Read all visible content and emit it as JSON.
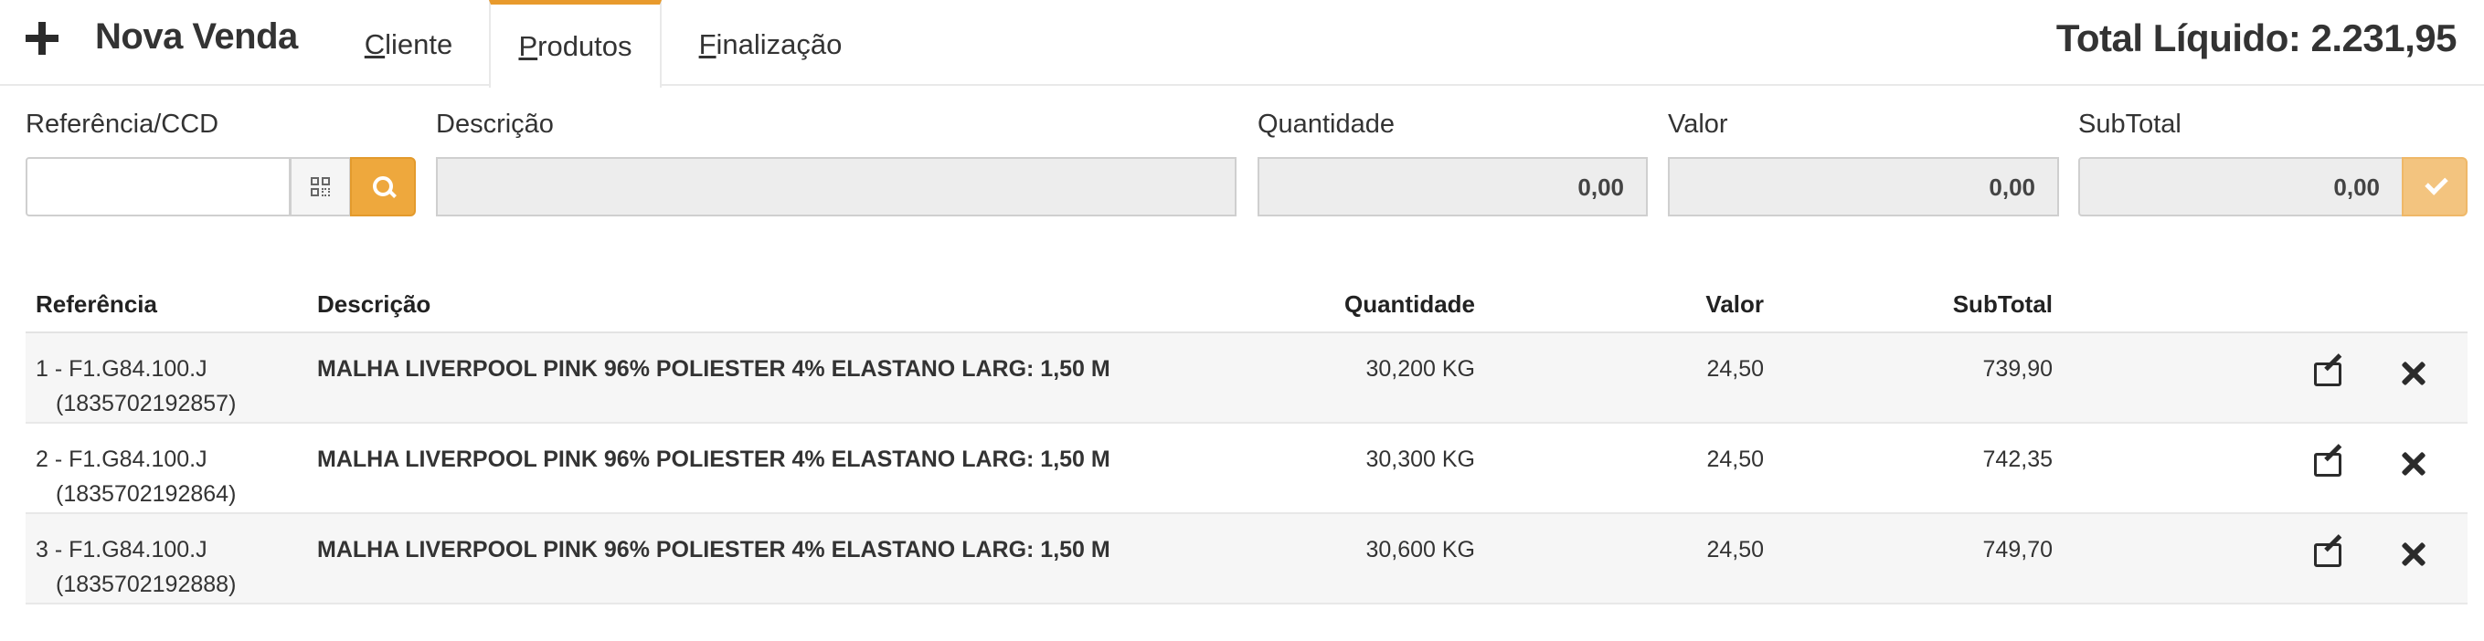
{
  "header": {
    "title": "Nova Venda",
    "tabs": [
      {
        "key": "C",
        "rest": "liente"
      },
      {
        "key": "P",
        "rest": "rodutos"
      },
      {
        "key": "F",
        "rest": "inalização"
      }
    ],
    "total_liquido": "Total Líquido: 2.231,95",
    "active_tab": "Produtos"
  },
  "form": {
    "ref_label": "Referência/CCD",
    "ref_value": "",
    "desc_label": "Descrição",
    "desc_value": "",
    "qtd_label": "Quantidade",
    "qtd_value": "0,00",
    "valor_label": "Valor",
    "valor_value": "0,00",
    "subtotal_label": "SubTotal",
    "subtotal_value": "0,00"
  },
  "table": {
    "headers": {
      "ref": "Referência",
      "desc": "Descrição",
      "qtd": "Quantidade",
      "valor": "Valor",
      "subtotal": "SubTotal"
    },
    "rows": [
      {
        "ref": "1 - F1.G84.100.J",
        "code": "(1835702192857)",
        "desc": "MALHA LIVERPOOL PINK 96% POLIESTER 4% ELASTANO LARG: 1,50 M",
        "qtd": "30,200 KG",
        "valor": "24,50",
        "subtotal": "739,90"
      },
      {
        "ref": "2 - F1.G84.100.J",
        "code": "(1835702192864)",
        "desc": "MALHA LIVERPOOL PINK 96% POLIESTER 4% ELASTANO LARG: 1,50 M",
        "qtd": "30,300 KG",
        "valor": "24,50",
        "subtotal": "742,35"
      },
      {
        "ref": "3 - F1.G84.100.J",
        "code": "(1835702192888)",
        "desc": "MALHA LIVERPOOL PINK 96% POLIESTER 4% ELASTANO LARG: 1,50 M",
        "qtd": "30,600 KG",
        "valor": "24,50",
        "subtotal": "749,70"
      }
    ]
  },
  "icons": {
    "add": "plus-icon",
    "qr": "qrcode-icon",
    "search": "search-icon",
    "confirm": "check-icon",
    "edit": "edit-icon",
    "delete": "close-icon"
  },
  "colors": {
    "accent": "#eea83d",
    "confirm_button": "#f3c47f",
    "disabled_field": "#ededed",
    "row_stripe": "#f6f6f6"
  }
}
